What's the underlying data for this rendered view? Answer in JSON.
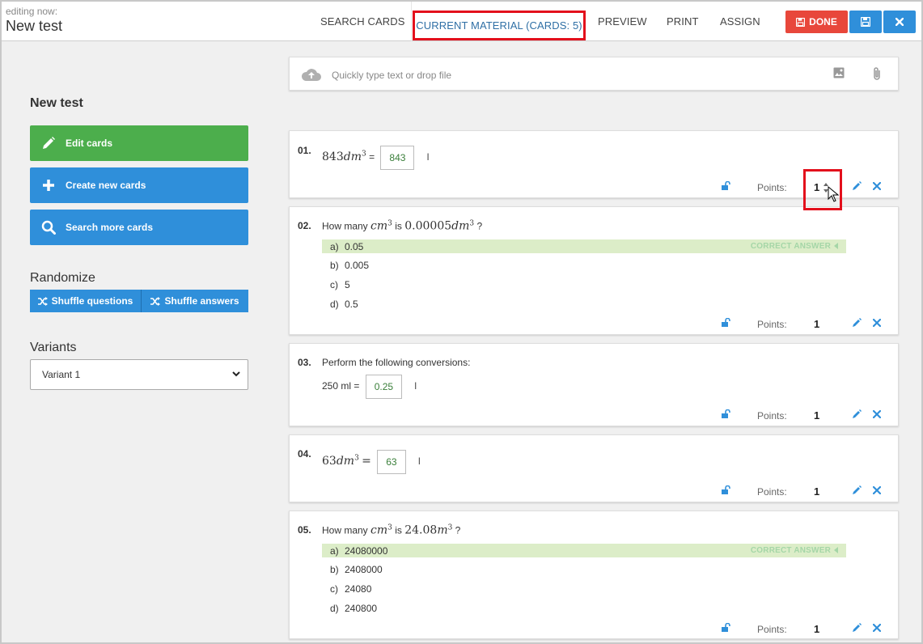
{
  "header": {
    "editing_label": "editing now:",
    "test_name": "New test",
    "nav": {
      "search": "SEARCH CARDS",
      "current": "CURRENT MATERIAL (CARDS: 5)",
      "preview": "PREVIEW",
      "print": "PRINT",
      "assign": "ASSIGN"
    },
    "done_label": "DONE"
  },
  "sidebar": {
    "title": "New test",
    "edit_cards": "Edit cards",
    "create_cards": "Create new cards",
    "search_cards": "Search more cards",
    "randomize_label": "Randomize",
    "shuffle_questions": "Shuffle questions",
    "shuffle_answers": "Shuffle answers",
    "variants_label": "Variants",
    "variant_selected": "Variant 1"
  },
  "quick_input": {
    "placeholder": "Quickly type text or drop file"
  },
  "points_label": "Points:",
  "correct_label": "CORRECT ANSWER",
  "cards": [
    {
      "num": "01.",
      "value_pre": "843",
      "expr_unit": "dm",
      "exp": "3",
      "eq": "=",
      "answer": "843",
      "unit_after": "l",
      "points": "1"
    },
    {
      "num": "02.",
      "q_pre": "How many ",
      "q_unit1": "cm",
      "q_exp1": "3",
      "q_mid": " is ",
      "q_num2": "0.00005",
      "q_unit2": "dm",
      "q_exp2": "3",
      "q_post": " ?",
      "options": [
        {
          "letter": "a)",
          "text": "0.05"
        },
        {
          "letter": "b)",
          "text": "0.005"
        },
        {
          "letter": "c)",
          "text": "5"
        },
        {
          "letter": "d)",
          "text": "0.5"
        }
      ],
      "points": "1"
    },
    {
      "num": "03.",
      "q_text": "Perform the following conversions:",
      "pre": "250 ml =",
      "answer": "0.25",
      "unit_after": "l",
      "points": "1"
    },
    {
      "num": "04.",
      "value_pre": "63",
      "expr_unit": "dm",
      "exp": "3",
      "eq": "=",
      "answer": "63",
      "unit_after": "l",
      "points": "1"
    },
    {
      "num": "05.",
      "q_pre": "How many ",
      "q_unit1": "cm",
      "q_exp1": "3",
      "q_mid": " is ",
      "q_num2": "24.08",
      "q_unit2": "m",
      "q_exp2": "3",
      "q_post": " ?",
      "options": [
        {
          "letter": "a)",
          "text": "24080000"
        },
        {
          "letter": "b)",
          "text": "2408000"
        },
        {
          "letter": "c)",
          "text": "24080"
        },
        {
          "letter": "d)",
          "text": "240800"
        }
      ],
      "points": "1"
    }
  ],
  "colors": {
    "accent_blue": "#2f8fda",
    "done_red": "#e8473b",
    "edit_green": "#4cae4c",
    "correct_bg": "#dcedc8",
    "highlight_red": "#e3101c"
  }
}
